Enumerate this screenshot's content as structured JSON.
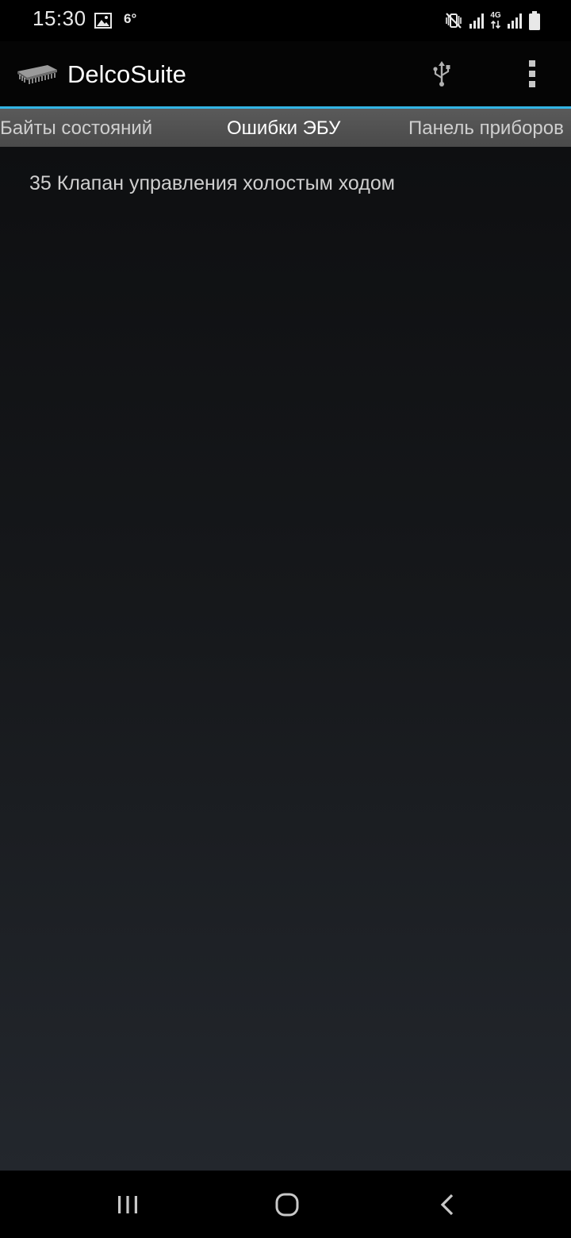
{
  "status_bar": {
    "time": "15:30",
    "temperature": "6°",
    "network": "4G",
    "icons": [
      "gallery-icon",
      "vibrate-mute-icon",
      "signal-icon",
      "data-arrows-icon",
      "signal-icon",
      "battery-icon"
    ]
  },
  "action_bar": {
    "title": "DelcoSuite",
    "logo_icon": "chip-icon",
    "actions": [
      "usb-icon",
      "overflow-menu-icon"
    ]
  },
  "tabs": [
    {
      "label": "Байты состояний",
      "active": false
    },
    {
      "label": "Ошибки ЭБУ",
      "active": true
    },
    {
      "label": "Панель приборов",
      "active": false
    }
  ],
  "errors": [
    {
      "text": "35 Клапан управления холостым ходом"
    }
  ],
  "nav_bar": {
    "icons": [
      "recents-icon",
      "home-icon",
      "back-icon"
    ]
  },
  "colors": {
    "accent": "#33b5e5",
    "tab_bg": "#555555",
    "background": "#0e0f11"
  }
}
